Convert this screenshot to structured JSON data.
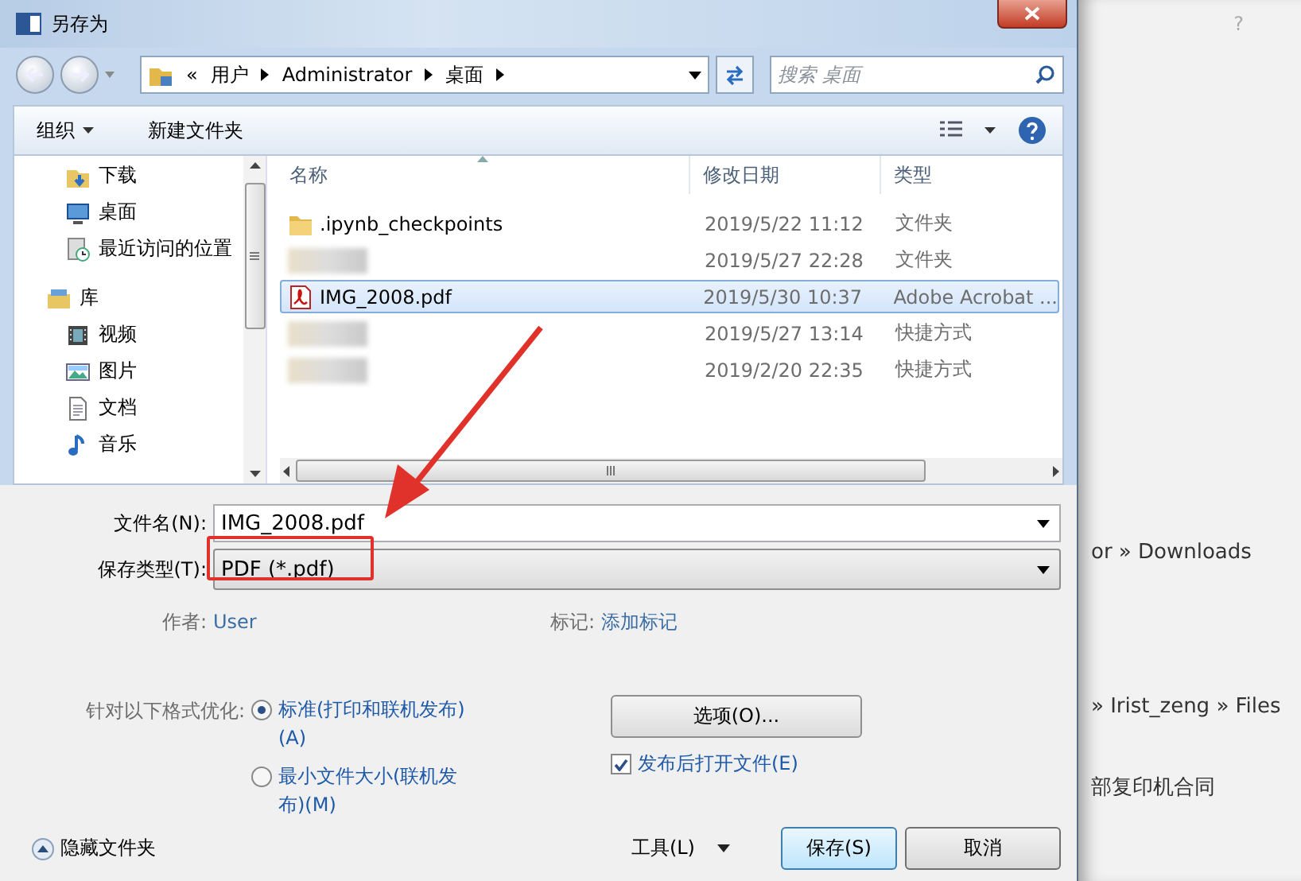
{
  "window": {
    "title": "另存为"
  },
  "address": {
    "overflow": "«",
    "segments": [
      "用户",
      "Administrator",
      "桌面"
    ]
  },
  "search": {
    "placeholder": "搜索 桌面"
  },
  "toolbar": {
    "organize": "组织",
    "new_folder": "新建文件夹"
  },
  "nav_pane": {
    "groups": [
      {
        "children": [
          {
            "label": "下载",
            "kind": "download"
          },
          {
            "label": "桌面",
            "kind": "desktop"
          },
          {
            "label": "最近访问的位置",
            "kind": "recent"
          }
        ]
      },
      {
        "label": "库",
        "kind": "library",
        "children": [
          {
            "label": "视频",
            "kind": "video"
          },
          {
            "label": "图片",
            "kind": "picture"
          },
          {
            "label": "文档",
            "kind": "document"
          },
          {
            "label": "音乐",
            "kind": "music"
          }
        ]
      }
    ]
  },
  "file_list": {
    "columns": [
      "名称",
      "修改日期",
      "类型"
    ],
    "rows": [
      {
        "name": ".ipynb_checkpoints",
        "kind": "folder",
        "date": "2019/5/22 11:12",
        "type": "文件夹",
        "selected": false
      },
      {
        "date": "2019/5/27 22:28",
        "type": "文件夹",
        "selected": false
      },
      {
        "name": "IMG_2008.pdf",
        "kind": "pdf",
        "date": "2019/5/30 10:37",
        "type": "Adobe Acrobat ...",
        "selected": true
      },
      {
        "date": "2019/5/27 13:14",
        "type": "快捷方式",
        "selected": false
      },
      {
        "date": "2019/2/20 22:35",
        "type": "快捷方式",
        "selected": false
      }
    ]
  },
  "form": {
    "file_name": {
      "label": "文件名(N):",
      "value": "IMG_2008.pdf"
    },
    "file_type": {
      "label": "保存类型(T):",
      "value": "PDF (*.pdf)"
    },
    "author": {
      "label": "作者:",
      "value": "User"
    },
    "tags": {
      "label": "标记:",
      "value": "添加标记"
    },
    "optimize": {
      "label": "针对以下格式优化:",
      "options": [
        {
          "label": "标准(打印和联机发布)(A)",
          "selected": true
        },
        {
          "label": "最小文件大小(联机发布)(M)",
          "selected": false
        }
      ]
    },
    "options_button": "选项(O)...",
    "open_after": {
      "label": "发布后打开文件(E)",
      "checked": true
    }
  },
  "footer": {
    "hide_folders": "隐藏文件夹",
    "tools": "工具(L)",
    "save": "保存(S)",
    "cancel": "取消"
  },
  "background": {
    "help": "?",
    "lines": [
      "or » Downloads",
      "» Irist_zeng » Files",
      "部复印机合同"
    ]
  }
}
